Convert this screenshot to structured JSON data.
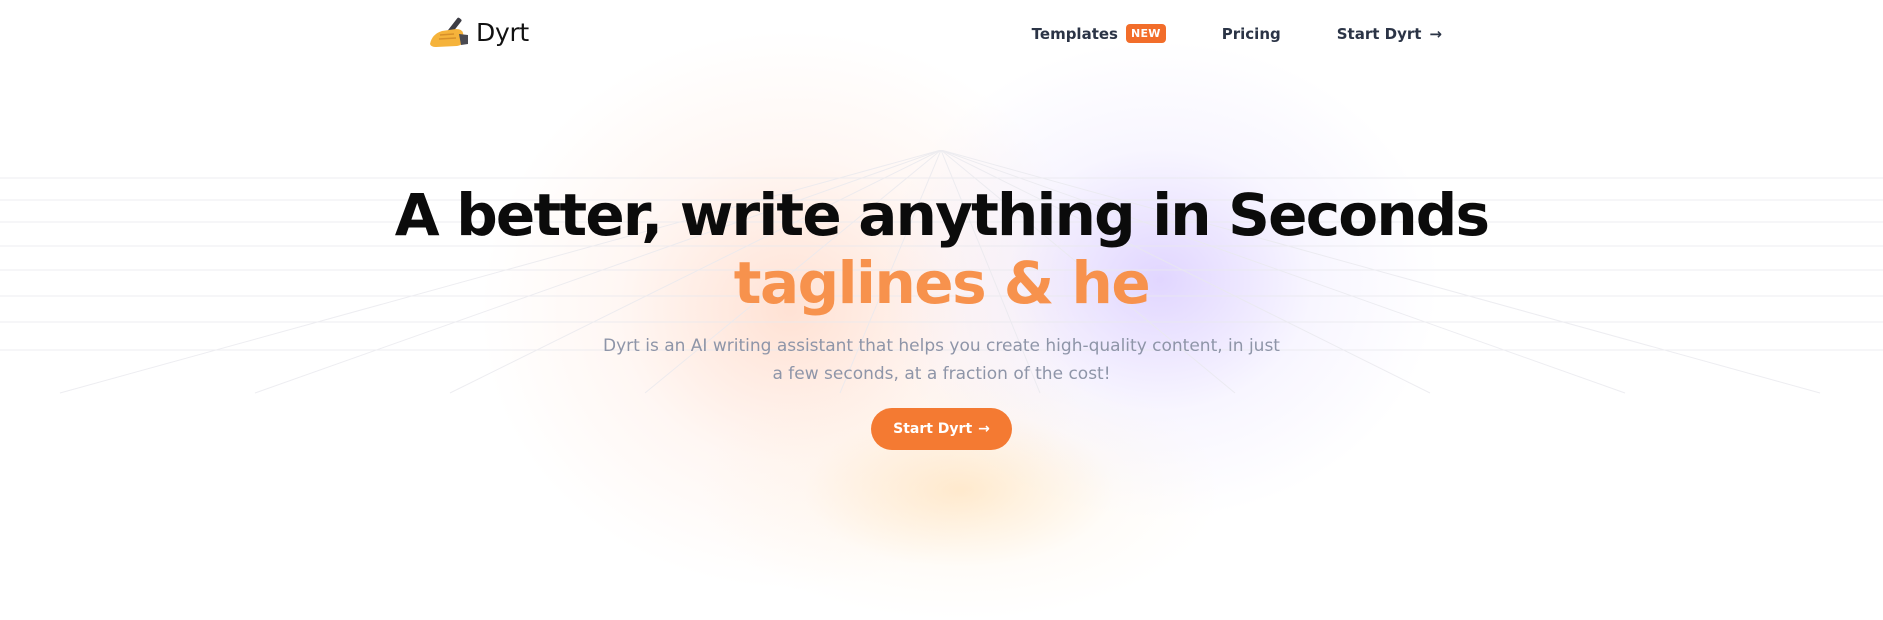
{
  "nav": {
    "logo_text": "Dyrt",
    "logo_icon": "writing-hand-icon",
    "links": [
      {
        "label": "Templates",
        "badge": "NEW"
      },
      {
        "label": "Pricing"
      },
      {
        "label": "Start Dyrt",
        "icon": "arrow-right-icon"
      }
    ]
  },
  "hero": {
    "headline": "A better, write anything in Seconds",
    "subheadline": "taglines & he",
    "description": "Dyrt is an AI writing assistant that helps you create high-quality content, in just a few seconds, at a fraction of the cost!",
    "cta_label": "Start Dyrt",
    "cta_icon": "arrow-right-icon"
  },
  "colors": {
    "accent": "#f47a32",
    "badge": "#f26d2a",
    "subheadline": "#f7924d",
    "muted_text": "#8e95a8",
    "nav_text": "#2b3446"
  }
}
